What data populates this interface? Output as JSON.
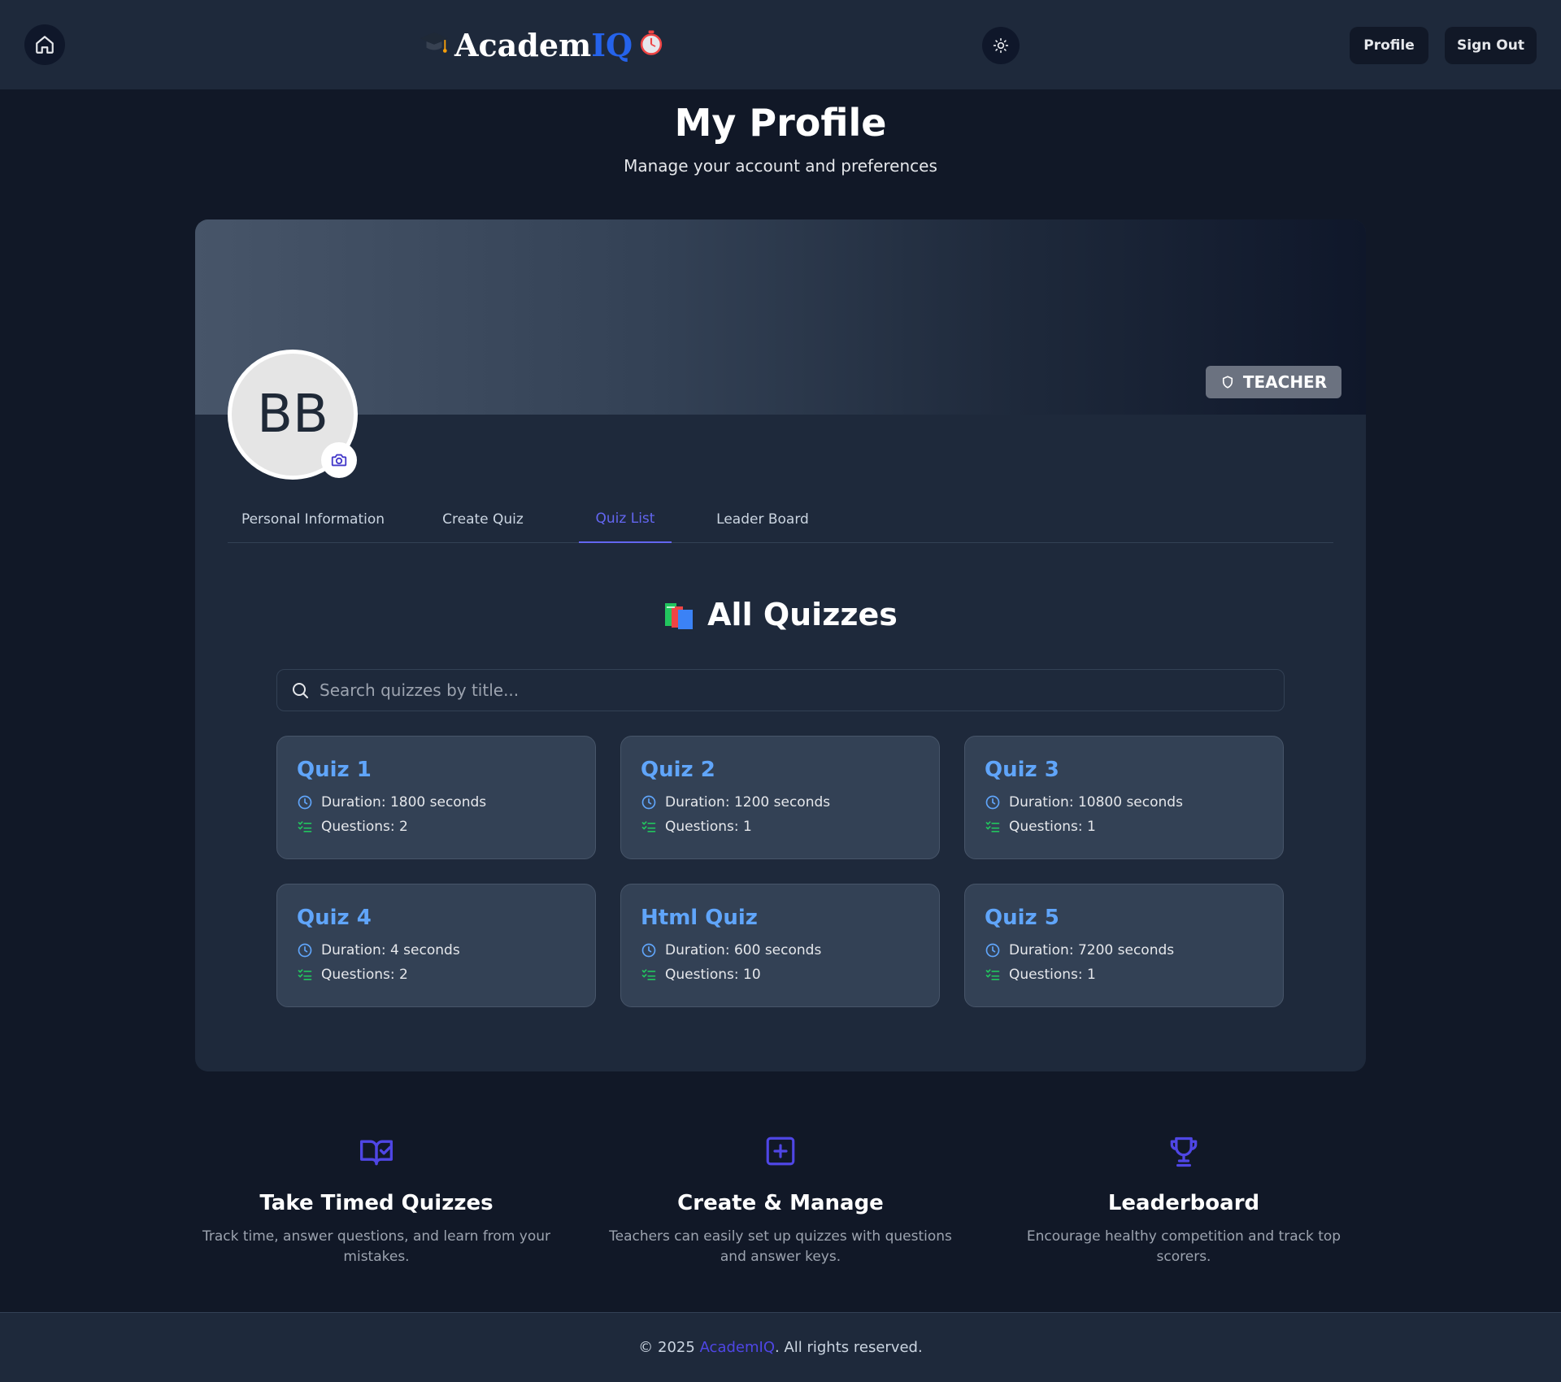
{
  "header": {
    "logo_main": "Academ",
    "logo_accent": "IQ",
    "nav_profile": "Profile",
    "nav_signout": "Sign Out"
  },
  "page": {
    "title": "My Profile",
    "subtitle": "Manage your account and preferences"
  },
  "profile": {
    "initials": "BB",
    "role": "TEACHER"
  },
  "tabs": [
    {
      "label": "Personal Information"
    },
    {
      "label": "Create Quiz"
    },
    {
      "label": "Quiz List",
      "active": true
    },
    {
      "label": "Leader Board"
    }
  ],
  "quiz_list": {
    "title": "All Quizzes",
    "search_placeholder": "Search quizzes by title...",
    "quizzes": [
      {
        "title": "Quiz 1",
        "duration": "Duration: 1800 seconds",
        "questions": "Questions: 2"
      },
      {
        "title": "Quiz 2",
        "duration": "Duration: 1200 seconds",
        "questions": "Questions: 1"
      },
      {
        "title": "Quiz 3",
        "duration": "Duration: 10800 seconds",
        "questions": "Questions: 1"
      },
      {
        "title": "Quiz 4",
        "duration": "Duration: 4 seconds",
        "questions": "Questions: 2"
      },
      {
        "title": "Html Quiz",
        "duration": "Duration: 600 seconds",
        "questions": "Questions: 10"
      },
      {
        "title": "Quiz 5",
        "duration": "Duration: 7200 seconds",
        "questions": "Questions: 1"
      }
    ]
  },
  "features": [
    {
      "icon": "book-check-icon",
      "title": "Take Timed Quizzes",
      "desc": "Track time, answer questions, and learn from your mistakes."
    },
    {
      "icon": "plus-square-icon",
      "title": "Create & Manage",
      "desc": "Teachers can easily set up quizzes with questions and answer keys."
    },
    {
      "icon": "trophy-icon",
      "title": "Leaderboard",
      "desc": "Encourage healthy competition and track top scorers."
    }
  ],
  "footer": {
    "prefix": "© 2025 ",
    "brand": "AcademIQ",
    "suffix": ". All rights reserved."
  },
  "colors": {
    "accent": "#6366f1",
    "quiz_title": "#60a5fa",
    "brand_blue": "#2563eb"
  }
}
